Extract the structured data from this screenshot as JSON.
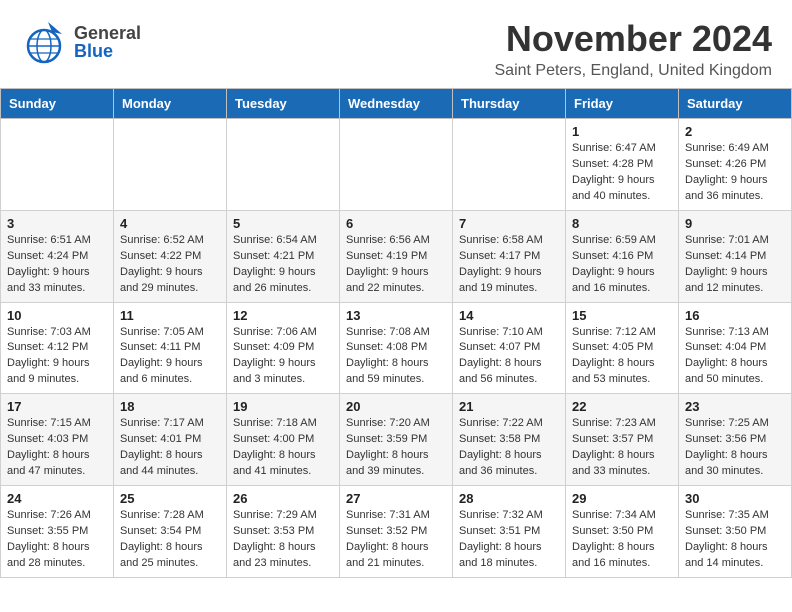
{
  "header": {
    "month_title": "November 2024",
    "location": "Saint Peters, England, United Kingdom",
    "logo_general": "General",
    "logo_blue": "Blue"
  },
  "days_of_week": [
    "Sunday",
    "Monday",
    "Tuesday",
    "Wednesday",
    "Thursday",
    "Friday",
    "Saturday"
  ],
  "weeks": [
    {
      "days": [
        {
          "num": "",
          "info": ""
        },
        {
          "num": "",
          "info": ""
        },
        {
          "num": "",
          "info": ""
        },
        {
          "num": "",
          "info": ""
        },
        {
          "num": "",
          "info": ""
        },
        {
          "num": "1",
          "info": "Sunrise: 6:47 AM\nSunset: 4:28 PM\nDaylight: 9 hours and 40 minutes."
        },
        {
          "num": "2",
          "info": "Sunrise: 6:49 AM\nSunset: 4:26 PM\nDaylight: 9 hours and 36 minutes."
        }
      ]
    },
    {
      "days": [
        {
          "num": "3",
          "info": "Sunrise: 6:51 AM\nSunset: 4:24 PM\nDaylight: 9 hours and 33 minutes."
        },
        {
          "num": "4",
          "info": "Sunrise: 6:52 AM\nSunset: 4:22 PM\nDaylight: 9 hours and 29 minutes."
        },
        {
          "num": "5",
          "info": "Sunrise: 6:54 AM\nSunset: 4:21 PM\nDaylight: 9 hours and 26 minutes."
        },
        {
          "num": "6",
          "info": "Sunrise: 6:56 AM\nSunset: 4:19 PM\nDaylight: 9 hours and 22 minutes."
        },
        {
          "num": "7",
          "info": "Sunrise: 6:58 AM\nSunset: 4:17 PM\nDaylight: 9 hours and 19 minutes."
        },
        {
          "num": "8",
          "info": "Sunrise: 6:59 AM\nSunset: 4:16 PM\nDaylight: 9 hours and 16 minutes."
        },
        {
          "num": "9",
          "info": "Sunrise: 7:01 AM\nSunset: 4:14 PM\nDaylight: 9 hours and 12 minutes."
        }
      ]
    },
    {
      "days": [
        {
          "num": "10",
          "info": "Sunrise: 7:03 AM\nSunset: 4:12 PM\nDaylight: 9 hours and 9 minutes."
        },
        {
          "num": "11",
          "info": "Sunrise: 7:05 AM\nSunset: 4:11 PM\nDaylight: 9 hours and 6 minutes."
        },
        {
          "num": "12",
          "info": "Sunrise: 7:06 AM\nSunset: 4:09 PM\nDaylight: 9 hours and 3 minutes."
        },
        {
          "num": "13",
          "info": "Sunrise: 7:08 AM\nSunset: 4:08 PM\nDaylight: 8 hours and 59 minutes."
        },
        {
          "num": "14",
          "info": "Sunrise: 7:10 AM\nSunset: 4:07 PM\nDaylight: 8 hours and 56 minutes."
        },
        {
          "num": "15",
          "info": "Sunrise: 7:12 AM\nSunset: 4:05 PM\nDaylight: 8 hours and 53 minutes."
        },
        {
          "num": "16",
          "info": "Sunrise: 7:13 AM\nSunset: 4:04 PM\nDaylight: 8 hours and 50 minutes."
        }
      ]
    },
    {
      "days": [
        {
          "num": "17",
          "info": "Sunrise: 7:15 AM\nSunset: 4:03 PM\nDaylight: 8 hours and 47 minutes."
        },
        {
          "num": "18",
          "info": "Sunrise: 7:17 AM\nSunset: 4:01 PM\nDaylight: 8 hours and 44 minutes."
        },
        {
          "num": "19",
          "info": "Sunrise: 7:18 AM\nSunset: 4:00 PM\nDaylight: 8 hours and 41 minutes."
        },
        {
          "num": "20",
          "info": "Sunrise: 7:20 AM\nSunset: 3:59 PM\nDaylight: 8 hours and 39 minutes."
        },
        {
          "num": "21",
          "info": "Sunrise: 7:22 AM\nSunset: 3:58 PM\nDaylight: 8 hours and 36 minutes."
        },
        {
          "num": "22",
          "info": "Sunrise: 7:23 AM\nSunset: 3:57 PM\nDaylight: 8 hours and 33 minutes."
        },
        {
          "num": "23",
          "info": "Sunrise: 7:25 AM\nSunset: 3:56 PM\nDaylight: 8 hours and 30 minutes."
        }
      ]
    },
    {
      "days": [
        {
          "num": "24",
          "info": "Sunrise: 7:26 AM\nSunset: 3:55 PM\nDaylight: 8 hours and 28 minutes."
        },
        {
          "num": "25",
          "info": "Sunrise: 7:28 AM\nSunset: 3:54 PM\nDaylight: 8 hours and 25 minutes."
        },
        {
          "num": "26",
          "info": "Sunrise: 7:29 AM\nSunset: 3:53 PM\nDaylight: 8 hours and 23 minutes."
        },
        {
          "num": "27",
          "info": "Sunrise: 7:31 AM\nSunset: 3:52 PM\nDaylight: 8 hours and 21 minutes."
        },
        {
          "num": "28",
          "info": "Sunrise: 7:32 AM\nSunset: 3:51 PM\nDaylight: 8 hours and 18 minutes."
        },
        {
          "num": "29",
          "info": "Sunrise: 7:34 AM\nSunset: 3:50 PM\nDaylight: 8 hours and 16 minutes."
        },
        {
          "num": "30",
          "info": "Sunrise: 7:35 AM\nSunset: 3:50 PM\nDaylight: 8 hours and 14 minutes."
        }
      ]
    }
  ]
}
